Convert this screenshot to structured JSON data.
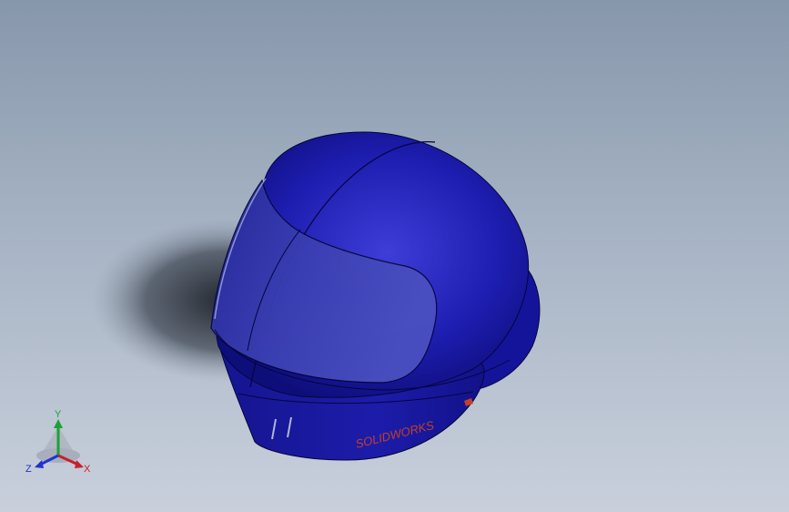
{
  "model": {
    "logo_text": "SOLIDWORKS",
    "colors": {
      "shell": "#1a1aa6",
      "shell_dark": "#0c0c6a",
      "visor": "#3d43b0",
      "logo": "#c2402a",
      "background_top": "#8797ab",
      "background_bottom": "#c9d0dc"
    }
  },
  "triad": {
    "x_label": "X",
    "y_label": "Y",
    "z_label": "Z",
    "colors": {
      "x": "#c8202a",
      "y": "#1aa334",
      "z": "#2233cc"
    }
  }
}
